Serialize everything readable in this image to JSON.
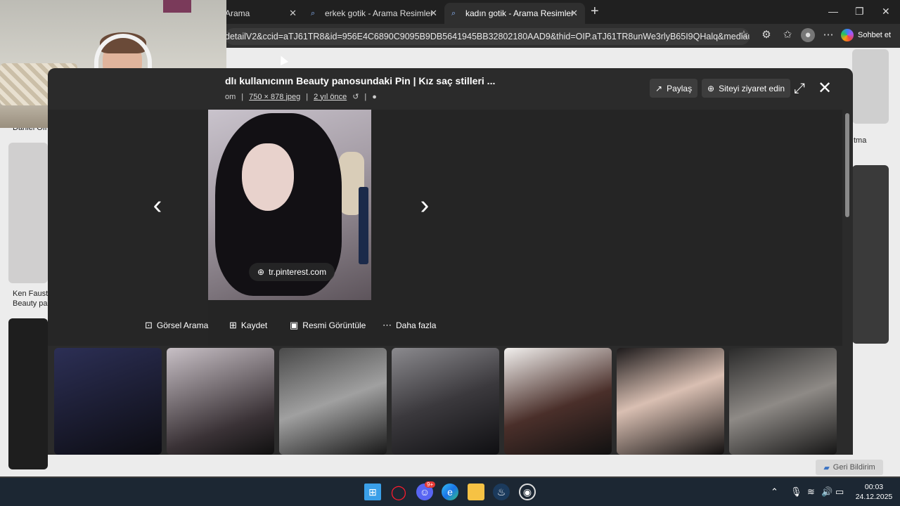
{
  "browser": {
    "tabs": [
      {
        "label": "Arama"
      },
      {
        "label": "erkek gotik - Arama Resimler"
      },
      {
        "label": "kadın gotik - Arama Resimler"
      }
    ],
    "url": "detailV2&ccid=aTJ61TR8&id=956E4C6890C9095B9DB5641945BB32802180AAD9&thid=OIP.aTJ61TR8unWe3rlyB65I9QHalq&mediaurl=htt...",
    "copilot_label": "Sohbet et"
  },
  "background": {
    "captions": [
      "Daniel Ofi",
      "Ken Faust",
      "Beauty pa",
      "tma"
    ]
  },
  "viewer": {
    "title": "dlı kullanıcının Beauty panosundaki Pin | Kız saç stilleri ...",
    "meta_source": "om",
    "meta_size": "750 × 878 jpeg",
    "meta_age": "2 yıl önce",
    "share_label": "Paylaş",
    "visit_label": "Siteyi ziyaret edin",
    "source_pill": "tr.pinterest.com",
    "actions": {
      "visual_search": "Görsel Arama",
      "save": "Kaydet",
      "view_image": "Resmi Görüntüle",
      "more": "Daha fazla"
    }
  },
  "feedback_label": "Geri Bildirim",
  "taskbar": {
    "time": "00:03",
    "date": "24.12.2025",
    "badge": "9+"
  }
}
